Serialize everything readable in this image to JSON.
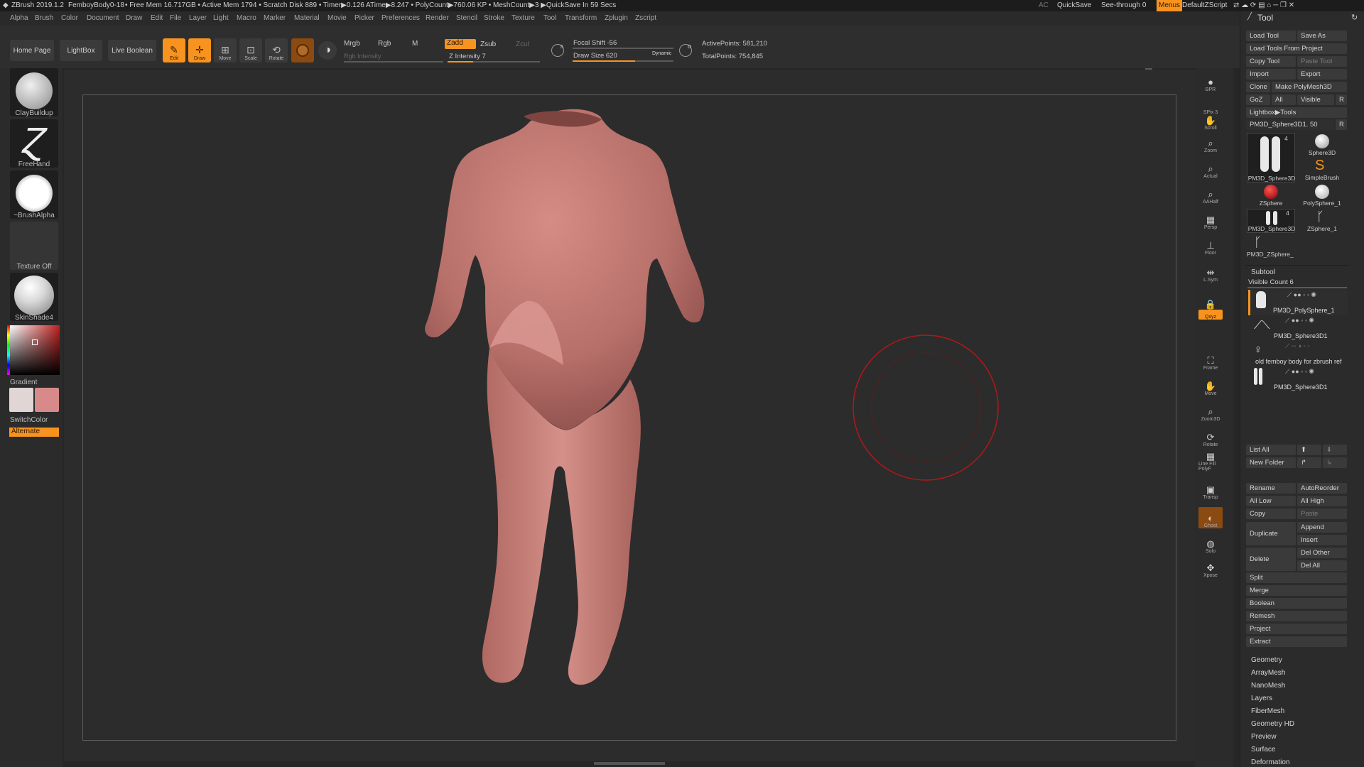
{
  "titlebar": {
    "app": "ZBrush 2019.1.2",
    "doc": "FemboyBody0-18",
    "stats": "• Free Mem 16.717GB • Active Mem 1794 • Scratch Disk 889 • Timer▶0.126 ATime▶8.247 • PolyCount▶760.06 KP • MeshCount▶3 ▶QuickSave In 59 Secs",
    "ac": "AC",
    "quicksave": "QuickSave",
    "see_through": "See-through  0",
    "menus": "Menus",
    "default_zscript": "DefaultZScript"
  },
  "menubar": [
    "Alpha",
    "Brush",
    "Color",
    "Document",
    "Draw",
    "Edit",
    "File",
    "Layer",
    "Light",
    "Macro",
    "Marker",
    "Material",
    "Movie",
    "Picker",
    "Preferences",
    "Render",
    "Stencil",
    "Stroke",
    "Texture",
    "Tool",
    "Transform",
    "Zplugin",
    "Zscript"
  ],
  "toolbar": {
    "home_page": "Home Page",
    "lightbox": "LightBox",
    "live_boolean": "Live Boolean",
    "edit": "Edit",
    "draw": "Draw",
    "move": "Move",
    "scale": "Scale",
    "rotate": "Rotate",
    "mrgb": "Mrgb",
    "rgb": "Rgb",
    "m": "M",
    "rgb_intensity": "Rgb Intensity",
    "zadd": "Zadd",
    "zsub": "Zsub",
    "zcut": "Zcut",
    "z_intensity": "Z Intensity 7",
    "focal_shift": "Focal Shift -56",
    "draw_size": "Draw Size 620",
    "dynamic": "Dynamic",
    "active_points": "ActivePoints: 581,210",
    "total_points": "TotalPoints: 754,845",
    "z_intensity_level": 0.28,
    "draw_size_level": 0.62
  },
  "left_shelf": {
    "brush": "ClayBuildup",
    "stroke": "FreeHand",
    "alpha": "~BrushAlpha",
    "texture": "Texture Off",
    "material": "SkinShade4",
    "gradient": "Gradient",
    "switch_color": "SwitchColor",
    "alternate": "Alternate"
  },
  "right_shelf": [
    {
      "name": "BPR",
      "icon": "sphere-icon"
    },
    {
      "name": "SPix 3",
      "icon": ""
    },
    {
      "name": "Scroll",
      "icon": "hand-icon"
    },
    {
      "name": "Zoom",
      "icon": "zoom-icon"
    },
    {
      "name": "Actual",
      "icon": "zoom-icon"
    },
    {
      "name": "AAHalf",
      "icon": "zoom-icon"
    },
    {
      "name": "Persp",
      "icon": "grid-icon"
    },
    {
      "name": "Floor",
      "icon": "floor-icon"
    },
    {
      "name": "L.Sym",
      "icon": "sym-icon"
    },
    {
      "name": "",
      "icon": "lock-icon"
    },
    {
      "name": "Qxyz",
      "icon": "xyz-icon"
    },
    {
      "name": "Frame",
      "icon": "frame-icon"
    },
    {
      "name": "Move",
      "icon": "hand-icon"
    },
    {
      "name": "Zoom3D",
      "icon": "zoom-icon"
    },
    {
      "name": "Rotate",
      "icon": "rotate-icon"
    },
    {
      "name": "Line Fill PolyF",
      "icon": "grid-icon"
    },
    {
      "name": "Transp",
      "icon": "transp-icon"
    },
    {
      "name": "Ghost",
      "icon": "ghost-icon"
    },
    {
      "name": "Solo",
      "icon": "solo-icon"
    },
    {
      "name": "Xpose",
      "icon": "xpose-icon"
    }
  ],
  "tool_panel": {
    "title": "Tool",
    "load_tool": "Load Tool",
    "save_as": "Save As",
    "load_tools_from_project": "Load Tools From Project",
    "copy_tool": "Copy Tool",
    "paste_tool": "Paste Tool",
    "import": "Import",
    "export": "Export",
    "clone": "Clone",
    "make_polymesh": "Make PolyMesh3D",
    "goz": "GoZ",
    "all": "All",
    "visible": "Visible",
    "r": "R",
    "lightbox_tools": "Lightbox▶Tools",
    "current_tool": "PM3D_Sphere3D1. 50",
    "tools": [
      {
        "label": "PM3D_Sphere3D",
        "count": "4"
      },
      {
        "label": "Sphere3D",
        "count": ""
      },
      {
        "label": "SimpleBrush",
        "count": ""
      },
      {
        "label": "ZSphere",
        "count": ""
      },
      {
        "label": "PolySphere_1",
        "count": ""
      },
      {
        "label": "PM3D_Sphere3D",
        "count": "4"
      },
      {
        "label": "ZSphere_1",
        "count": ""
      },
      {
        "label": "PM3D_ZSphere_",
        "count": ""
      }
    ],
    "subtool_title": "Subtool",
    "visible_count": "Visible Count 6",
    "subtools": [
      "PM3D_PolySphere_1",
      "PM3D_Sphere3D1",
      "old femboy body for zbrush ref",
      "PM3D_Sphere3D1"
    ],
    "list_all": "List All",
    "new_folder": "New Folder",
    "rename": "Rename",
    "auto_reorder": "AutoReorder",
    "all_low": "All Low",
    "all_high": "All High",
    "copy": "Copy",
    "paste": "Paste",
    "duplicate": "Duplicate",
    "append": "Append",
    "insert": "Insert",
    "delete": "Delete",
    "del_other": "Del Other",
    "del_all": "Del All",
    "split": "Split",
    "merge": "Merge",
    "boolean": "Boolean",
    "remesh": "Remesh",
    "project": "Project",
    "extract": "Extract",
    "sections": [
      "Geometry",
      "ArrayMesh",
      "NanoMesh",
      "Layers",
      "FiberMesh",
      "Geometry HD",
      "Preview",
      "Surface",
      "Deformation"
    ]
  },
  "colors": {
    "accent": "#f7931e",
    "skin": "#c07872",
    "brush_cursor": "#b01818"
  }
}
